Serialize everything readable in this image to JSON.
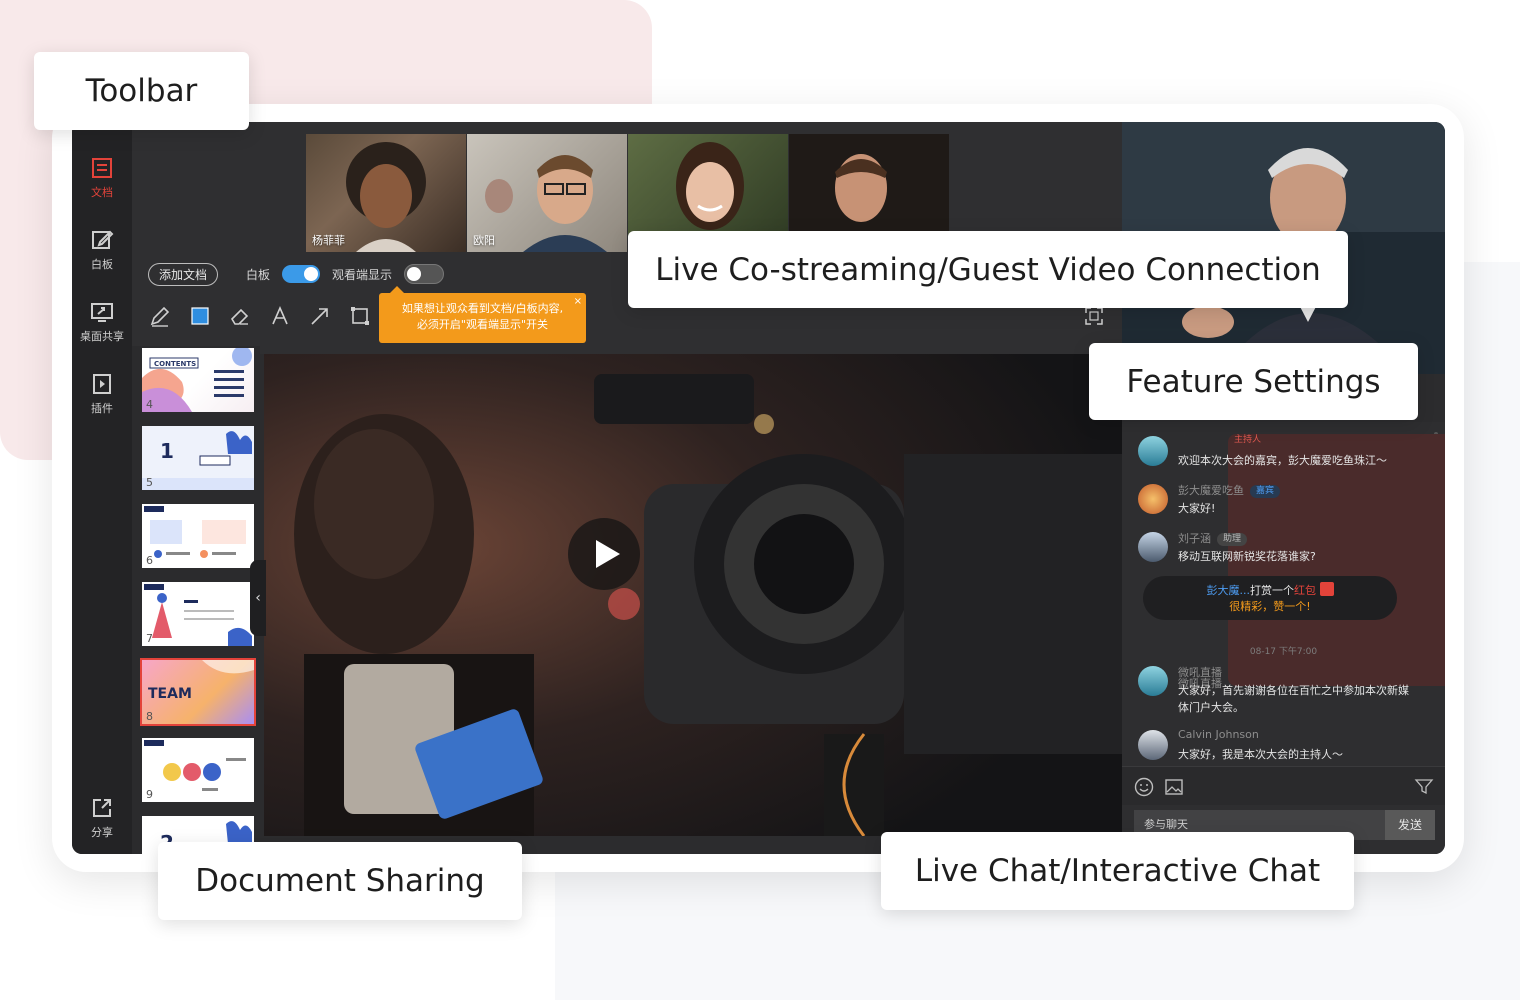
{
  "callouts": {
    "toolbar": "Toolbar",
    "costream": "Live Co-streaming/Guest Video Connection",
    "features": "Feature Settings",
    "document": "Document Sharing",
    "chat": "Live Chat/Interactive Chat"
  },
  "sidebar": {
    "items": [
      {
        "label": "文档",
        "icon": "document-icon",
        "active": true
      },
      {
        "label": "白板",
        "icon": "whiteboard-icon"
      },
      {
        "label": "桌面共享",
        "icon": "screen-share-icon"
      },
      {
        "label": "插件",
        "icon": "plugin-icon"
      }
    ],
    "share_label": "分享"
  },
  "guests": [
    {
      "name": "杨菲菲"
    },
    {
      "name": "欧阳"
    },
    {
      "name": ""
    },
    {
      "name": ""
    }
  ],
  "controls": {
    "add_doc": "添加文档",
    "whiteboard_label": "白板",
    "whiteboard_on": true,
    "viewer_label": "观看端显示",
    "viewer_on": false
  },
  "tooltip": {
    "line1": "如果想让观众看到文档/白板内容,",
    "line2": "必须开启\"观看端显示\"开关",
    "close": "×"
  },
  "thumbnails": [
    {
      "page": "4",
      "title": "CONTENTS"
    },
    {
      "page": "5",
      "title": "1"
    },
    {
      "page": "6",
      "title": ""
    },
    {
      "page": "7",
      "title": ""
    },
    {
      "page": "8",
      "title": "TEAM",
      "selected": true
    },
    {
      "page": "9",
      "title": ""
    },
    {
      "page": "",
      "title": "2"
    }
  ],
  "chat": {
    "messages": [
      {
        "name": "微吼直播",
        "role": "主持人",
        "role_type": "host",
        "text": "欢迎本次大会的嘉宾，彭大魔爱吃鱼珠江～"
      },
      {
        "name": "彭大魔爱吃鱼",
        "role": "嘉宾",
        "role_type": "guest",
        "text": "大家好!"
      },
      {
        "name": "刘子涵",
        "role": "助理",
        "role_type": "assist",
        "text": "移动互联网新锐奖花落谁家?"
      },
      {
        "name": "微吼直播",
        "role": "",
        "role_type": "",
        "text": "大家好，首先谢谢各位在百忙之中参加本次新媒体门户大会。"
      },
      {
        "name": "Calvin Johnson",
        "role": "",
        "role_type": "",
        "text": "大家好，我是本次大会的主持人～"
      }
    ],
    "gift": {
      "user": "彭大魔...",
      "action": "打赏一个",
      "item": "红包",
      "line2": "很精彩，赞一个!"
    },
    "timestamp": "08-17 下午7:00",
    "input_placeholder": "参与聊天",
    "send_label": "发送"
  },
  "colors": {
    "accent": "#e3433a",
    "blue": "#3b9ae8",
    "tooltip": "#f39a1b"
  }
}
